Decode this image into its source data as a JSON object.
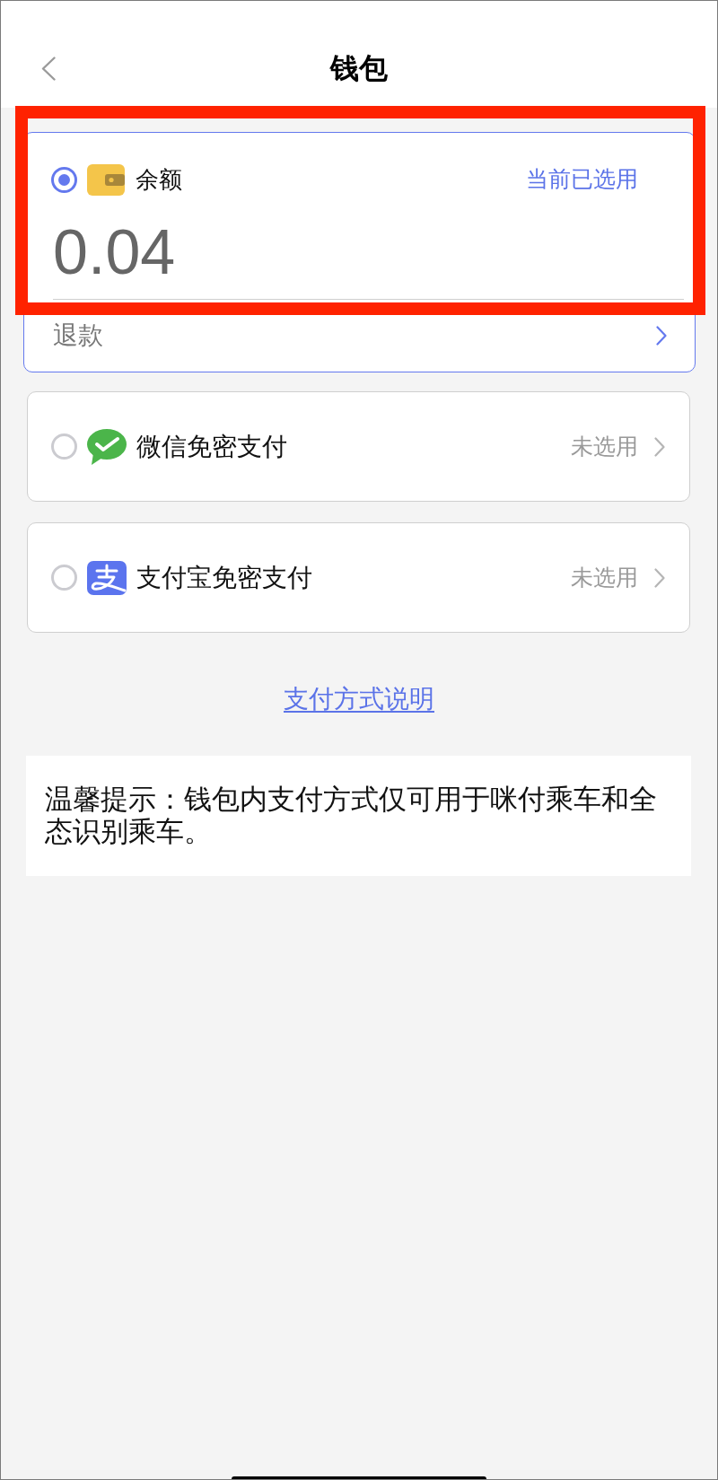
{
  "header": {
    "title": "钱包"
  },
  "payment_methods": [
    {
      "kind": "balance",
      "name": "余额",
      "selected": true,
      "highlighted": true,
      "status": "当前已选用",
      "amount": "0.04",
      "refund_label": "退款"
    },
    {
      "kind": "wechat",
      "name": "微信免密支付",
      "selected": false,
      "highlighted": false,
      "status": "未选用"
    },
    {
      "kind": "alipay",
      "name": "支付宝免密支付",
      "selected": false,
      "highlighted": false,
      "status": "未选用"
    }
  ],
  "explanation_link": "支付方式说明",
  "tip": "温馨提示：钱包内支付方式仅可用于咪付乘车和全态识别乘车。"
}
